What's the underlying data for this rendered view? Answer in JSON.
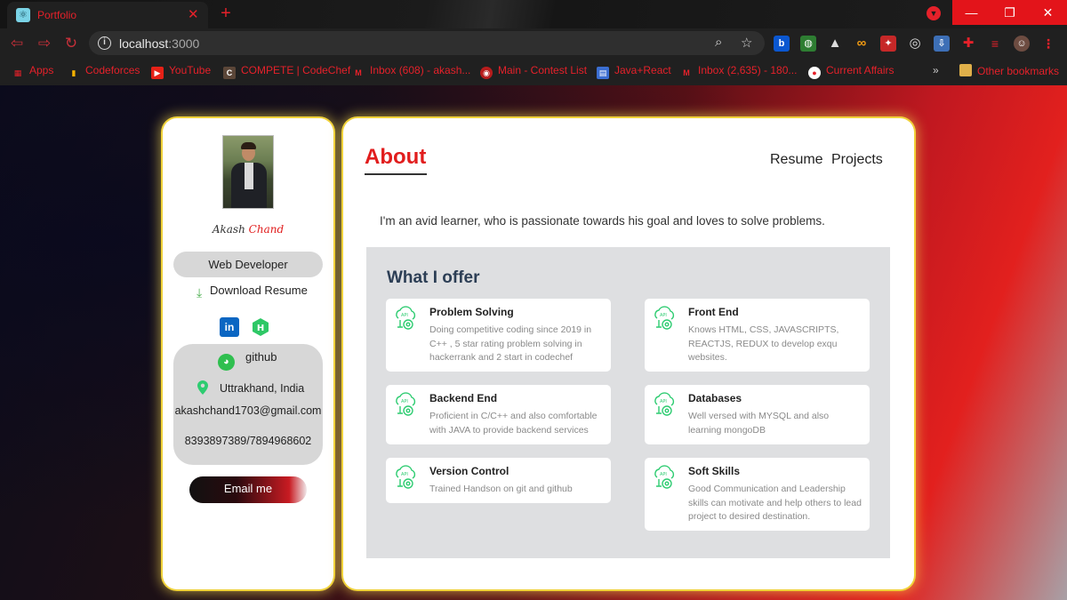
{
  "browser": {
    "tab_title": "Portfolio",
    "tab_close": "✕",
    "new_tab": "+",
    "url_host": "localhost",
    "url_port": ":3000",
    "bookmarks": [
      {
        "label": "Apps",
        "icon": "apps-grid-icon"
      },
      {
        "label": "Codeforces",
        "icon": "codeforces-icon"
      },
      {
        "label": "YouTube",
        "icon": "youtube-icon"
      },
      {
        "label": "COMPETE | CodeChef",
        "icon": "codechef-icon"
      },
      {
        "label": "Inbox (608) - akash...",
        "icon": "gmail-icon"
      },
      {
        "label": "Main - Contest List",
        "icon": "contest-icon"
      },
      {
        "label": "Java+React",
        "icon": "calendar-icon"
      },
      {
        "label": "Inbox (2,635) - 180...",
        "icon": "gmail-icon"
      },
      {
        "label": "Current Affairs",
        "icon": "news-icon"
      }
    ],
    "overflow": "»",
    "other_bookmarks": "Other bookmarks",
    "accent": "#e5212a"
  },
  "profile": {
    "first_name": "Akash",
    "last_name": "Chand",
    "role": "Web Developer",
    "download_label": "Download Resume",
    "github_label": "github",
    "location": "Uttrakhand, India",
    "email": "akashchand1703@gmail.com",
    "phone": "8393897389/7894968602",
    "email_button": "Email me",
    "linkedin_glyph": "in",
    "hackerrank_glyph": "H"
  },
  "main": {
    "title": "About",
    "nav": [
      "Resume",
      "Projects"
    ],
    "intro": "I'm an avid learner, who is passionate towards his goal and loves to solve problems.",
    "offer_title": "What I offer",
    "offers": [
      {
        "name": "Problem Solving",
        "desc": "Doing competitive coding since 2019 in C++ , 5 star rating problem solving in hackerrank and 2 start in codechef"
      },
      {
        "name": "Front End",
        "desc": "Knows HTML, CSS, JAVASCRIPTS, REACTJS, REDUX to develop exqu websites."
      },
      {
        "name": "Backend End",
        "desc": "Proficient in C/C++ and also comfortable with JAVA to provide backend services"
      },
      {
        "name": "Databases",
        "desc": "Well versed with MYSQL and also learning mongoDB"
      },
      {
        "name": "Version Control",
        "desc": "Trained Handson on git and github"
      },
      {
        "name": "Soft Skills",
        "desc": "Good Communication and Leadership skills can motivate and help others to lead project to desired destination."
      }
    ],
    "accent": "#e11d1d",
    "icon_color": "#2ecc71"
  }
}
